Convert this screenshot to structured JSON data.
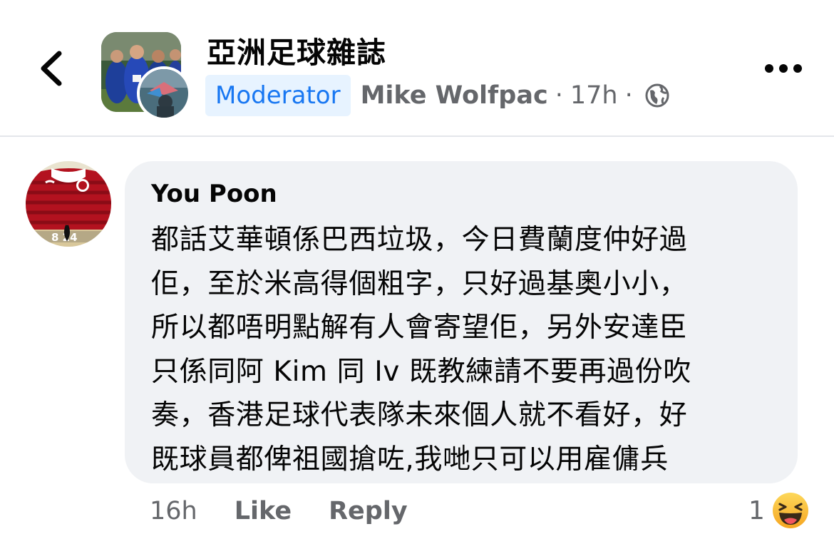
{
  "header": {
    "group_name": "亞洲足球雜誌",
    "badge": "Moderator",
    "author": "Mike Wolfpac",
    "separator": "·",
    "time": "17h",
    "icons": {
      "back": "chevron-left-icon",
      "audience": "globe-icon",
      "more": "more-horizontal-icon"
    }
  },
  "comment": {
    "name": "You Poon",
    "lines": [
      "都話艾華頓係巴西垃圾，今日費蘭度仲好過",
      "佢，至於米高得個粗字，只好過基奧小小，",
      "所以都唔明點解有人會寄望佢，另外安達臣",
      "只係同阿 Kim 同 Iv 既教練請不要再過份吹",
      "奏，香港足球代表隊未來個人就不看好，好",
      "既球員都俾祖國搶咗,我哋只可以用雇傭兵"
    ],
    "avatar_text": "8 24",
    "time": "16h",
    "like_label": "Like",
    "reply_label": "Reply",
    "reaction_count": "1",
    "reaction_icon": "haha-emoji-icon"
  },
  "colors": {
    "accent": "#1877f2",
    "badge_bg": "#e7f3ff",
    "secondary_text": "#65676b",
    "bubble_bg": "#f0f2f5"
  }
}
